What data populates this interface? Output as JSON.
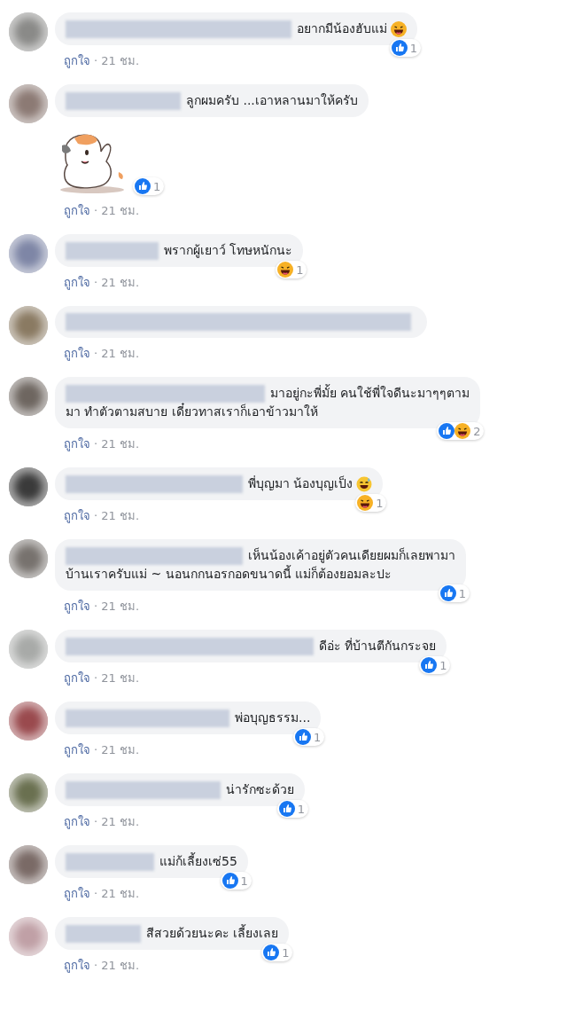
{
  "comments": [
    {
      "color": "#8a8a88",
      "lines": [
        "อยากมีน้องฮับแม่"
      ],
      "emoji": {
        "kind": "grin"
      },
      "reactions": [
        {
          "kind": "like"
        }
      ],
      "reaction_count": "1",
      "like_label": "ถูกใจ",
      "time": "· 21 ชม."
    },
    {
      "color": "#8c7a74",
      "lines": [
        "ลูกผมครับ ...เอาหลานมาให้ครับ"
      ],
      "sticker": true,
      "reactions": [
        {
          "kind": "like"
        }
      ],
      "reaction_count": "1",
      "like_label": "ถูกใจ",
      "time": "· 21 ชม."
    },
    {
      "color": "#7e86a6",
      "lines": [
        "พรากผู้เยาว์ โทษหนักนะ"
      ],
      "reactions": [
        {
          "kind": "haha"
        }
      ],
      "reaction_count": "1",
      "like_label": "ถูกใจ",
      "time": "· 21 ชม."
    },
    {
      "color": "#8a7a62",
      "like_label": "ถูกใจ",
      "time": "· 21 ชม."
    },
    {
      "color": "#6e6660",
      "lines": [
        "มาอยู่กะพี่มั้ย คนใช้พี่ใจดีนะมาๆๆตาม",
        "มา ทำตัวตามสบาย เดี๋ยวทาสเราก็เอาข้าวมาให้"
      ],
      "reactions": [
        {
          "kind": "like"
        },
        {
          "kind": "haha"
        }
      ],
      "reaction_count": "2",
      "like_label": "ถูกใจ",
      "time": "· 21 ชม."
    },
    {
      "color": "#3a3a3a",
      "lines": [
        "พี่บุญมา น้องบุญเป็ง"
      ],
      "emoji": {
        "kind": "sweat"
      },
      "reactions": [
        {
          "kind": "haha"
        }
      ],
      "reaction_count": "1",
      "like_label": "ถูกใจ",
      "time": "· 21 ชม."
    },
    {
      "color": "#77726e",
      "lines": [
        "เห็นน้องเค้าอยู่ตัวคนเดียยผมก็เลยพามา",
        "บ้านเราครับแม่ ~ นอนกกนอรกอดขนาดนี้ แม่ก็ต้องยอมละปะ"
      ],
      "reactions": [
        {
          "kind": "like"
        }
      ],
      "reaction_count": "1",
      "like_label": "ถูกใจ",
      "time": "· 21 ชม."
    },
    {
      "color": "#a8aaa8",
      "lines": [
        "ดีอ่ะ ที่บ้านตีกันกระจย"
      ],
      "reactions": [
        {
          "kind": "like"
        }
      ],
      "reaction_count": "1",
      "like_label": "ถูกใจ",
      "time": "· 21 ชม."
    },
    {
      "color": "#9a4a4e",
      "lines": [
        "พ่อบุญธรรม..."
      ],
      "reactions": [
        {
          "kind": "like"
        }
      ],
      "reaction_count": "1",
      "like_label": "ถูกใจ",
      "time": "· 21 ชม."
    },
    {
      "color": "#6a7050",
      "lines": [
        "น่ารักซะด้วย"
      ],
      "reactions": [
        {
          "kind": "like"
        }
      ],
      "reaction_count": "1",
      "like_label": "ถูกใจ",
      "time": "· 21 ชม."
    },
    {
      "color": "#7a6a66",
      "lines": [
        "แม่ก้เลี้ยงเซ่55"
      ],
      "reactions": [
        {
          "kind": "like"
        }
      ],
      "reaction_count": "1",
      "like_label": "ถูกใจ",
      "time": "· 21 ชม."
    },
    {
      "color": "#c0a0a6",
      "lines": [
        "สีสวยด้วยนะคะ เลี้ยงเลย"
      ],
      "reactions": [
        {
          "kind": "like"
        }
      ],
      "reaction_count": "1",
      "like_label": "ถูกใจ",
      "time": "· 21 ชม."
    }
  ]
}
